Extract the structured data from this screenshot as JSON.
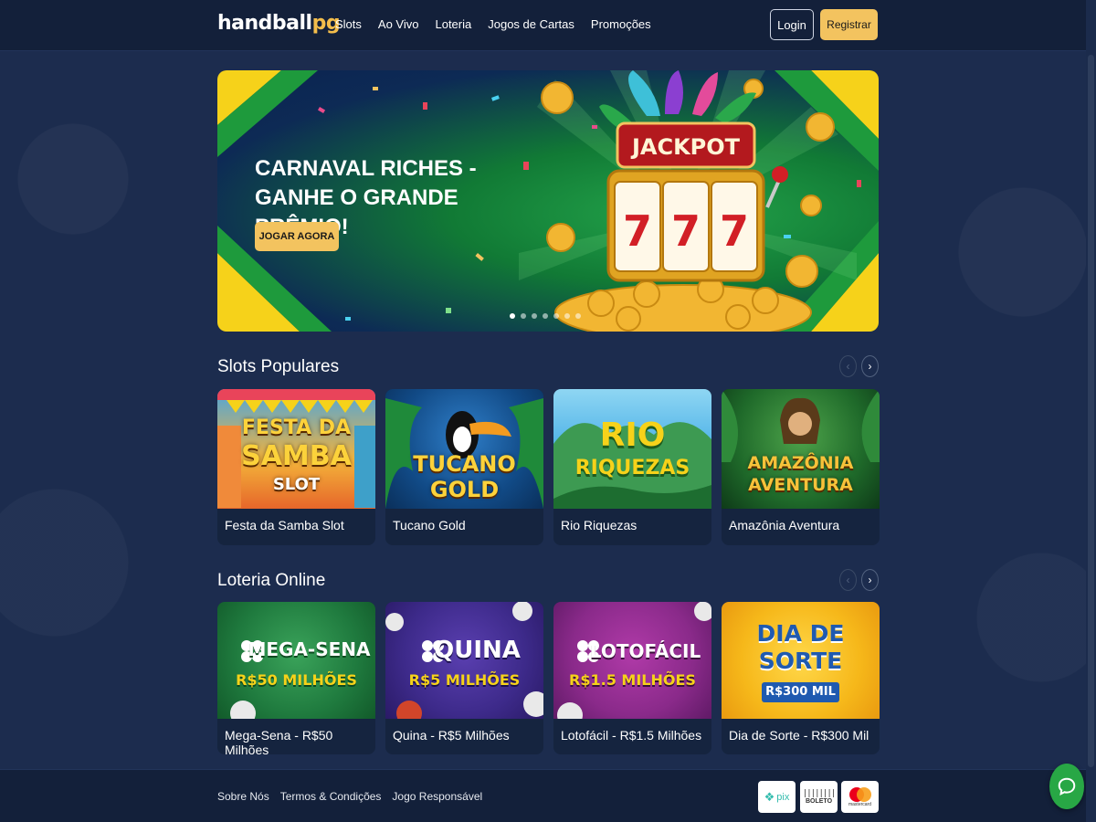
{
  "header": {
    "logo_main": "handball",
    "logo_accent": "pg",
    "nav": [
      "Slots",
      "Ao Vivo",
      "Loteria",
      "Jogos de Cartas",
      "Promoções"
    ],
    "login_label": "Login",
    "register_label": "Registrar"
  },
  "hero": {
    "title": "CARNAVAL RICHES -\nGANHE O GRANDE PRÊMIO!",
    "cta_label": "JOGAR AGORA",
    "jackpot_sign": "JACKPOT",
    "reel_symbols": [
      "7",
      "7",
      "7"
    ],
    "slide_count": 7,
    "active_slide": 0
  },
  "slots": {
    "title": "Slots Populares",
    "items": [
      {
        "label": "Festa da Samba Slot",
        "art_lines": [
          "FESTA DA",
          "SAMBA",
          "SLOT"
        ]
      },
      {
        "label": "Tucano Gold",
        "art_lines": [
          "TUCANO",
          "GOLD"
        ]
      },
      {
        "label": "Rio Riquezas",
        "art_lines": [
          "RIO",
          "RIQUEZAS"
        ]
      },
      {
        "label": "Amazônia Aventura",
        "art_lines": [
          "AMAZÔNIA",
          "AVENTURA"
        ]
      }
    ]
  },
  "lottery": {
    "title": "Loteria Online",
    "items": [
      {
        "label": "Mega-Sena - R$50 Milhões",
        "art_name": "MEGA-SENA",
        "art_prize": "R$50 MILHÕES"
      },
      {
        "label": "Quina - R$5 Milhões",
        "art_name": "QUINA",
        "art_prize": "R$5 MILHÕES"
      },
      {
        "label": "Lotofácil - R$1.5 Milhões",
        "art_name": "LOTOFÁCIL",
        "art_prize": "R$1.5 MILHÕES"
      },
      {
        "label": "Dia de Sorte - R$300 Mil",
        "art_name": "DIA DE SORTE",
        "art_prize": "R$300 MIL"
      }
    ]
  },
  "footer": {
    "links": [
      "Sobre Nós",
      "Termos & Condições",
      "Jogo Responsável"
    ],
    "payments": [
      "pix",
      "BOLETO",
      "mastercard"
    ]
  },
  "icons": {
    "prev": "chevron-left-icon",
    "next": "chevron-right-icon",
    "chat": "chat-icon"
  },
  "colors": {
    "accent": "#f3c35f",
    "background": "#1c2c4e",
    "header": "#13203a",
    "chat": "#28a745"
  }
}
